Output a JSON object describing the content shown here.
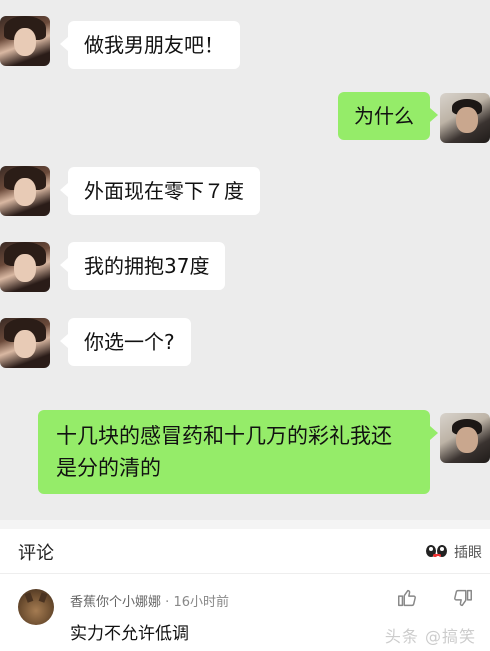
{
  "chat": {
    "messages": [
      {
        "side": "left",
        "text": "做我男朋友吧！"
      },
      {
        "side": "right",
        "text": "为什么"
      },
      {
        "side": "left",
        "text": "外面现在零下７度"
      },
      {
        "side": "left",
        "text": "我的拥抱37度"
      },
      {
        "side": "left",
        "text": "你选一个?"
      },
      {
        "side": "right",
        "text": "十几块的感冒药和十几万的彩礼我还是分的清的"
      }
    ]
  },
  "comments": {
    "title": "评论",
    "sticker_icon": "eyes-sticker-icon",
    "sticker_label": "插眼",
    "items": [
      {
        "username": "香蕉你个小娜娜",
        "separator": "·",
        "time": "16小时前",
        "text": "实力不允许低调",
        "like_icon": "thumbs-up-icon",
        "dislike_icon": "thumbs-down-icon"
      }
    ],
    "watermark": "头条 @搞笑"
  },
  "colors": {
    "chat_bg": "#ececec",
    "left_bubble": "#ffffff",
    "right_bubble": "#95ec69"
  }
}
